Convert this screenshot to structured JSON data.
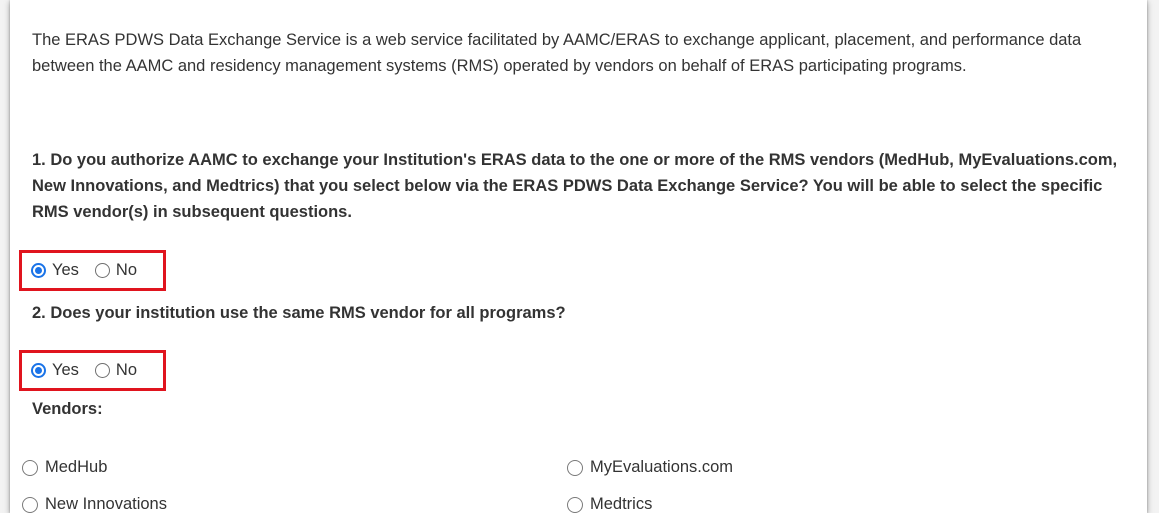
{
  "intro": "The ERAS PDWS Data Exchange Service is a web service facilitated by AAMC/ERAS to exchange applicant, placement, and performance data between the AAMC and residency management systems (RMS) operated by vendors on behalf of ERAS participating programs.",
  "questions": [
    {
      "text": "1. Do you authorize AAMC to exchange your Institution's ERAS data to the one or more of the RMS vendors (MedHub, MyEvaluations.com, New Innovations, and Medtrics) that you select below via the ERAS PDWS Data Exchange Service? You will be able to select the specific RMS vendor(s) in subsequent questions.",
      "options": [
        "Yes",
        "No"
      ],
      "selected": "Yes"
    },
    {
      "text": "2. Does your institution use the same RMS vendor for all programs?",
      "options": [
        "Yes",
        "No"
      ],
      "selected": "Yes"
    }
  ],
  "vendors_label": "Vendors:",
  "vendors": [
    "MedHub",
    "MyEvaluations.com",
    "New Innovations",
    "Medtrics"
  ],
  "colors": {
    "highlight": "#e0141e",
    "radio_selected": "#1a73e8",
    "text": "#333333"
  }
}
